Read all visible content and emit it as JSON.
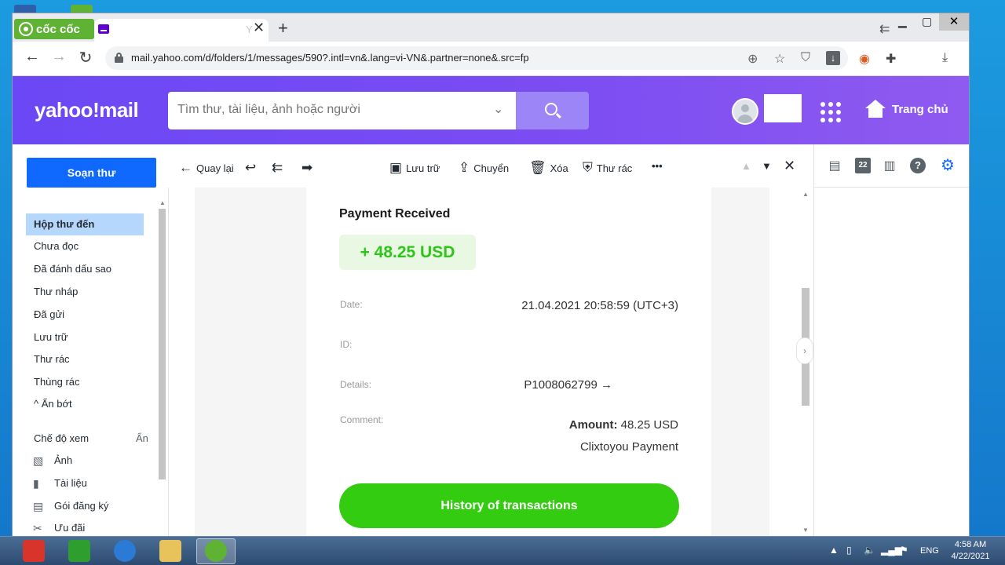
{
  "browser": {
    "brand": "cốc cốc",
    "tab_partial_title": "Y",
    "new_tab_label": "+",
    "close_tab_label": "✕",
    "url": "mail.yahoo.com/d/folders/1/messages/590?.intl=vn&.lang=vi-VN&.partner=none&.src=fp"
  },
  "yahoo": {
    "logo": "yahoo!mail",
    "search_placeholder": "Tìm thư, tài liệu, ảnh hoặc người",
    "home_label": "Trang chủ"
  },
  "sidebar": {
    "compose_label": "Soạn thư",
    "folders": [
      {
        "label": "Hộp thư đến"
      },
      {
        "label": "Chưa đọc"
      },
      {
        "label": "Đã đánh dấu sao"
      },
      {
        "label": "Thư nháp"
      },
      {
        "label": "Đã gửi"
      },
      {
        "label": "Lưu trữ"
      },
      {
        "label": "Thư rác"
      },
      {
        "label": "Thùng rác"
      }
    ],
    "collapse_label": "Ẩn bớt",
    "views_label": "Chế độ xem",
    "views_hide": "Ẩn",
    "views": [
      {
        "label": "Ảnh"
      },
      {
        "label": "Tài liệu"
      },
      {
        "label": "Gói đăng ký"
      },
      {
        "label": "Ưu đãi"
      }
    ]
  },
  "msg_toolbar": {
    "back_label": "Quay lại",
    "archive_label": "Lưu trữ",
    "move_label": "Chuyển",
    "delete_label": "Xóa",
    "spam_label": "Thư rác"
  },
  "email": {
    "title": "Payment Received",
    "amount": "+ 48.25 USD",
    "date_label": "Date:",
    "date_value": "21.04.2021 20:58:59 (UTC+3)",
    "id_label": "ID:",
    "details_label": "Details:",
    "details_value": "P1008062799 →",
    "comment_label": "Comment:",
    "comment_amount_label": "Amount:",
    "comment_amount_value": "48.25 USD",
    "comment_text": "Clixtoyou Payment",
    "history_button": "History of transactions"
  },
  "rail": {
    "calendar_day": "22"
  },
  "taskbar": {
    "lang": "ENG",
    "time": "4:58 AM",
    "date": "4/22/2021"
  }
}
